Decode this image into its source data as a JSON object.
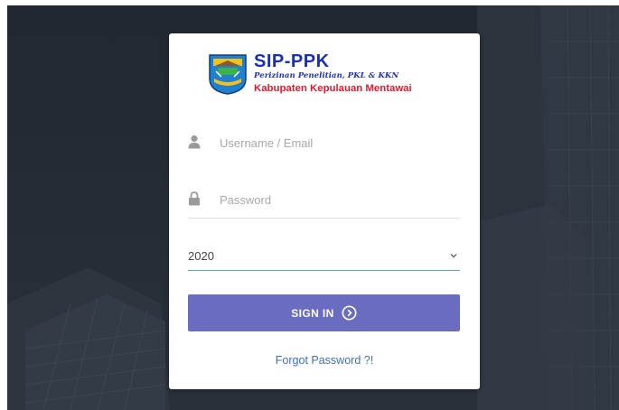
{
  "logo": {
    "app_name": "SIP-PPK",
    "tagline": "Perizinan Penelitian, PKL & KKN",
    "region": "Kabupaten Kepulauan Mentawai"
  },
  "form": {
    "username_placeholder": "Username / Email",
    "password_placeholder": "Password",
    "year_selected": "2020",
    "signin_label": "SIGN IN",
    "forgot_label": "Forgot Password ?!"
  },
  "colors": {
    "button": "#6a6cbf",
    "link": "#3f6fc3",
    "select_underline": "#4fb3a0",
    "brand_blue": "#1a2fb8",
    "brand_red": "#e8172c"
  },
  "icons": {
    "username": "user-icon",
    "password": "lock-icon",
    "select": "chevron-down-icon",
    "signin": "arrow-circle-right-icon"
  }
}
